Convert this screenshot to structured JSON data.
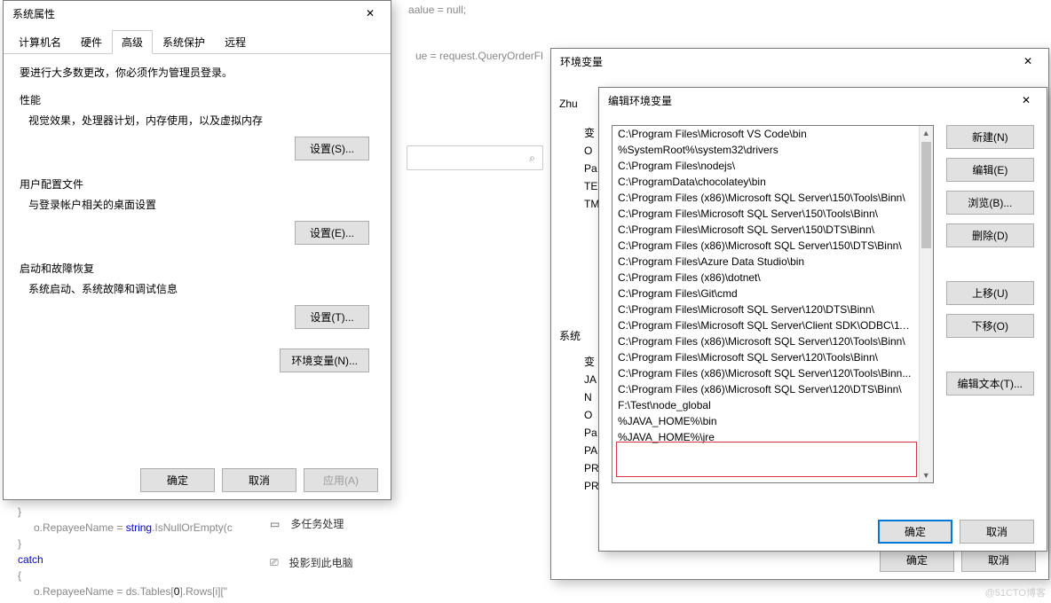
{
  "code": {
    "l1": "alue = null;",
    "l2": "ue = request.QueryOrderFl",
    "l3": "o.RepayeeName = ",
    "l3kw": "string",
    "l3b": ".IsNullOrEmpty(c",
    "l4": "catch",
    "l5a": "o.RepayeeName = ds.Tables[",
    "l5n": "0",
    "l5b": "].Rows[i][\""
  },
  "sysprops": {
    "title": "系统属性",
    "tabs": [
      "计算机名",
      "硬件",
      "高级",
      "系统保护",
      "远程"
    ],
    "intro": "要进行大多数更改，你必须作为管理员登录。",
    "perf_title": "性能",
    "perf_desc": "视觉效果，处理器计划，内存使用，以及虚拟内存",
    "btn_settings_s": "设置(S)...",
    "profile_title": "用户配置文件",
    "profile_desc": "与登录帐户相关的桌面设置",
    "btn_settings_e": "设置(E)...",
    "startup_title": "启动和故障恢复",
    "startup_desc": "系统启动、系统故障和调试信息",
    "btn_settings_t": "设置(T)...",
    "btn_envvar": "环境变量(N)...",
    "ok": "确定",
    "cancel": "取消",
    "apply": "应用(A)"
  },
  "settings": {
    "multitask": "多任务处理",
    "project": "投影到此电脑"
  },
  "envdialog": {
    "title": "环境变量",
    "zhu": "Zhu",
    "left_labels": [
      "变",
      "O",
      "Pa",
      "TE",
      "TM"
    ],
    "sys": "系统",
    "sys_labels": [
      "变",
      "JA",
      "N",
      "O",
      "Pa",
      "PA",
      "PR",
      "PR"
    ],
    "ok": "确定",
    "cancel": "取消"
  },
  "editenv": {
    "title": "编辑环境变量",
    "items": [
      "C:\\Program Files\\Microsoft VS Code\\bin",
      "%SystemRoot%\\system32\\drivers",
      "C:\\Program Files\\nodejs\\",
      "C:\\ProgramData\\chocolatey\\bin",
      "C:\\Program Files (x86)\\Microsoft SQL Server\\150\\Tools\\Binn\\",
      "C:\\Program Files\\Microsoft SQL Server\\150\\Tools\\Binn\\",
      "C:\\Program Files\\Microsoft SQL Server\\150\\DTS\\Binn\\",
      "C:\\Program Files (x86)\\Microsoft SQL Server\\150\\DTS\\Binn\\",
      "C:\\Program Files\\Azure Data Studio\\bin",
      "C:\\Program Files (x86)\\dotnet\\",
      "C:\\Program Files\\Git\\cmd",
      "C:\\Program Files\\Microsoft SQL Server\\120\\DTS\\Binn\\",
      "C:\\Program Files\\Microsoft SQL Server\\Client SDK\\ODBC\\11...",
      "C:\\Program Files (x86)\\Microsoft SQL Server\\120\\Tools\\Binn\\",
      "C:\\Program Files\\Microsoft SQL Server\\120\\Tools\\Binn\\",
      "C:\\Program Files (x86)\\Microsoft SQL Server\\120\\Tools\\Binn...",
      "C:\\Program Files (x86)\\Microsoft SQL Server\\120\\DTS\\Binn\\",
      "F:\\Test\\node_global",
      "%JAVA_HOME%\\bin",
      "%JAVA_HOME%\\jre"
    ],
    "btn_new": "新建(N)",
    "btn_edit": "编辑(E)",
    "btn_browse": "浏览(B)...",
    "btn_delete": "删除(D)",
    "btn_up": "上移(U)",
    "btn_down": "下移(O)",
    "btn_edittext": "编辑文本(T)...",
    "ok": "确定",
    "cancel": "取消"
  },
  "watermark": "@51CTO博客"
}
